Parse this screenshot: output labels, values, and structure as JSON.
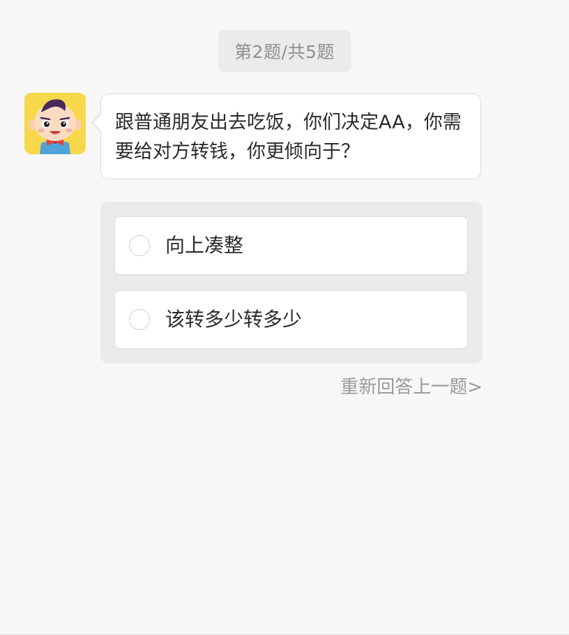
{
  "progress": {
    "text": "第2题/共5题"
  },
  "question": {
    "text": "跟普通朋友出去吃饭，你们决定AA，你需要给对方转钱，你更倾向于？"
  },
  "options": [
    {
      "label": "向上凑整",
      "selected": false
    },
    {
      "label": "该转多少转多少",
      "selected": false
    }
  ],
  "actions": {
    "redo_label": "重新回答上一题>"
  },
  "colors": {
    "background": "#f7f7f7",
    "avatar_bg": "#f7d84a",
    "panel_bg": "#eaeaea",
    "muted_text": "#9a9a9a"
  }
}
